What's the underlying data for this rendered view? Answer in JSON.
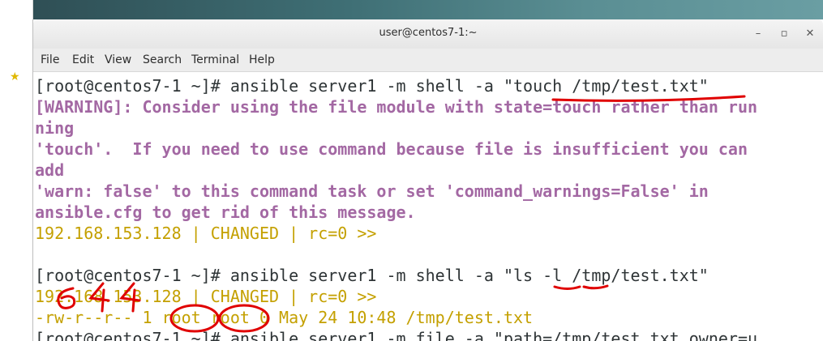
{
  "window": {
    "title": "user@centos7-1:~"
  },
  "menu": [
    "File",
    "Edit",
    "View",
    "Search",
    "Terminal",
    "Help"
  ],
  "terminal": {
    "lines": [
      "[root@centos7-1 ~]# ansible server1 -m shell -a \"touch /tmp/test.txt\"",
      "[WARNING]: Consider using the file module with state=touch rather than run",
      "ning",
      "'touch'.  If you need to use command because file is insufficient you can",
      "add",
      "'warn: false' to this command task or set 'command_warnings=False' in",
      "ansible.cfg to get rid of this message.",
      "192.168.153.128 | CHANGED | rc=0 >>",
      "",
      "[root@centos7-1 ~]# ansible server1 -m shell -a \"ls -l /tmp/test.txt\"",
      "192.168.153.128 | CHANGED | rc=0 >>",
      "-rw-r--r-- 1 root root 0 May 24 10:48 /tmp/test.txt",
      "[root@centos7-1 ~]# ansible server1 -m file -a \"path=/tmp/test.txt owner=u"
    ]
  },
  "colors": {
    "prompt": "#2e3436",
    "warning": "#a368a3",
    "changed": "#c4a000",
    "annotation": "#e00000"
  },
  "icons": {
    "minimize": "minimize-icon",
    "maximize": "maximize-icon",
    "close": "close-icon",
    "star": "star-icon"
  },
  "handwritten_annotation": "644"
}
